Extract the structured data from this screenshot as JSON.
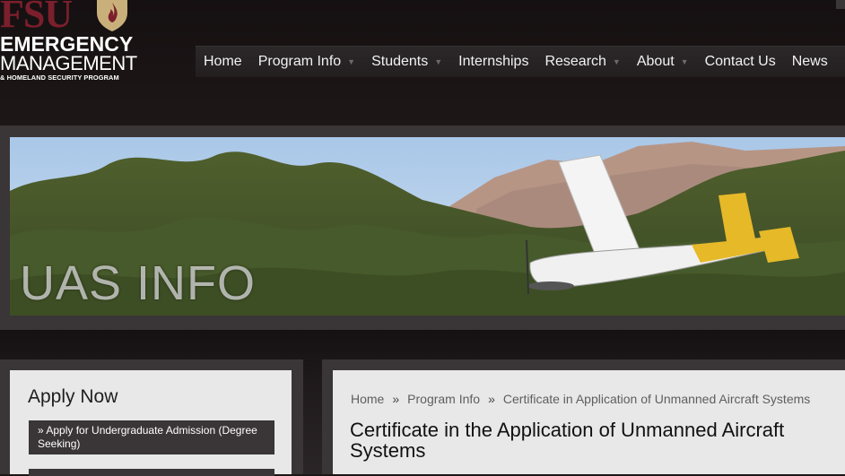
{
  "logo": {
    "fsu": "FSU",
    "line1": "EMERGENCY",
    "line2": "MANAGEMENT",
    "line3": "& HOMELAND SECURITY PROGRAM"
  },
  "nav": {
    "items": [
      {
        "label": "Home",
        "has_dropdown": false
      },
      {
        "label": "Program Info",
        "has_dropdown": true
      },
      {
        "label": "Students",
        "has_dropdown": true
      },
      {
        "label": "Internships",
        "has_dropdown": false
      },
      {
        "label": "Research",
        "has_dropdown": true
      },
      {
        "label": "About",
        "has_dropdown": true
      },
      {
        "label": "Contact Us",
        "has_dropdown": false
      },
      {
        "label": "News",
        "has_dropdown": false
      }
    ]
  },
  "banner": {
    "caption": "UAS INFO"
  },
  "sidebar": {
    "title": "Apply Now",
    "items": [
      {
        "label": "» Apply for Undergraduate Admission (Degree Seeking)"
      }
    ]
  },
  "main": {
    "breadcrumb": [
      "Home",
      "Program Info",
      "Certificate in Application of Unmanned Aircraft Systems"
    ],
    "breadcrumb_sep": "»",
    "title": "Certificate in the Application of Unmanned Aircraft Systems"
  },
  "colors": {
    "brand_garnet": "#7b1f2c",
    "brand_gold": "#c9b07a",
    "nav_bg": "#2a2627",
    "frame": "#3a3536",
    "panel": "#e8e8e8"
  }
}
